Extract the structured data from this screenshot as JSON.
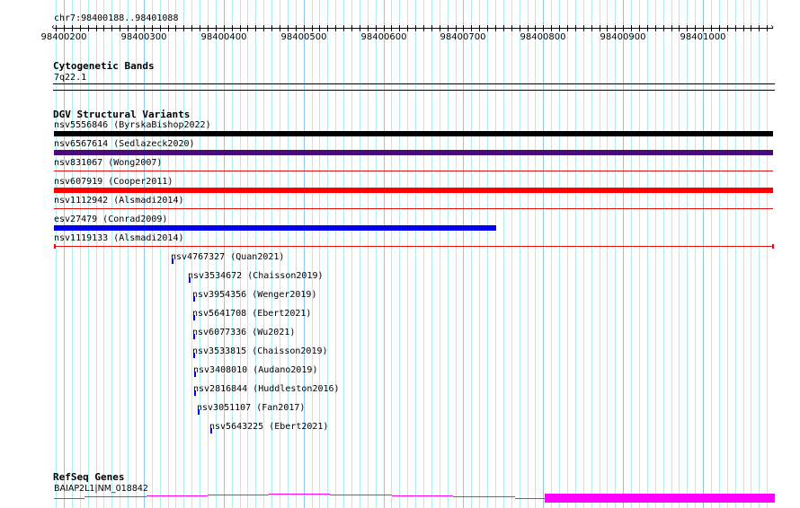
{
  "ruler": {
    "location": "chr7:98400188..98401088",
    "start": 98400188,
    "end": 98401088,
    "tick_labels": [
      "98400200",
      "98400300",
      "98400400",
      "98400500",
      "98400600",
      "98400700",
      "98400800",
      "98400900",
      "98401000"
    ]
  },
  "tracks": {
    "cytobands": {
      "title": "Cytogenetic Bands",
      "band": "7q22.1"
    },
    "dgv": {
      "title": "DGV Structural Variants",
      "features": [
        {
          "label": "nsv5556846 (ByrskaBishop2022)",
          "start": 98400188,
          "end": 98401088,
          "color": "#000000",
          "thick": true
        },
        {
          "label": "nsv6567614 (Sedlazeck2020)",
          "start": 98400188,
          "end": 98401088,
          "color": "#4b0a7a",
          "thick": true
        },
        {
          "label": "nsv831067 (Wong2007)",
          "start": 98400188,
          "end": 98401088,
          "color": "#e01010",
          "thick": false
        },
        {
          "label": "nsv607919 (Cooper2011)",
          "start": 98400188,
          "end": 98401088,
          "color": "#ff0000",
          "thick": true
        },
        {
          "label": "nsv1112942 (Alsmadi2014)",
          "start": 98400188,
          "end": 98401088,
          "color": "#e01010",
          "thick": false
        },
        {
          "label": "esv27479 (Conrad2009)",
          "start": 98400188,
          "end": 98400741,
          "color": "#0000ee",
          "thick": true
        },
        {
          "label": "nsv1119133 (Alsmadi2014)",
          "start": 98400188,
          "end": 98401088,
          "color": "#e01010",
          "thick": false,
          "endcaps": true
        },
        {
          "label": "nsv4767327 (Quan2021)",
          "start": 98400336,
          "end": 98400338,
          "color": "#0000ee",
          "small": true
        },
        {
          "label": "nsv3534672 (Chaisson2019)",
          "start": 98400357,
          "end": 98400359,
          "color": "#0000ee",
          "small": true
        },
        {
          "label": "nsv3954356 (Wenger2019)",
          "start": 98400362,
          "end": 98400364,
          "color": "#0000ee",
          "small": true
        },
        {
          "label": "nsv5641708 (Ebert2021)",
          "start": 98400362,
          "end": 98400364,
          "color": "#0000ee",
          "small": true
        },
        {
          "label": "nsv6077336 (Wu2021)",
          "start": 98400362,
          "end": 98400364,
          "color": "#0000ee",
          "small": true
        },
        {
          "label": "nsv3533815 (Chaisson2019)",
          "start": 98400362,
          "end": 98400364,
          "color": "#0000ee",
          "small": true
        },
        {
          "label": "nsv3408010 (Audano2019)",
          "start": 98400363,
          "end": 98400365,
          "color": "#0000ee",
          "small": true
        },
        {
          "label": "nsv2816844 (Huddleston2016)",
          "start": 98400363,
          "end": 98400365,
          "color": "#0000ee",
          "small": true
        },
        {
          "label": "nsv3051107 (Fan2017)",
          "start": 98400367,
          "end": 98400369,
          "color": "#0000ee",
          "small": true
        },
        {
          "label": "nsv5643225 (Ebert2021)",
          "start": 98400383,
          "end": 98400385,
          "color": "#0000ee",
          "small": true
        }
      ]
    },
    "refseq": {
      "title": "RefSeq Genes",
      "gene": "BAIAP2L1|NM_018842",
      "color": "#ff00ff"
    }
  }
}
